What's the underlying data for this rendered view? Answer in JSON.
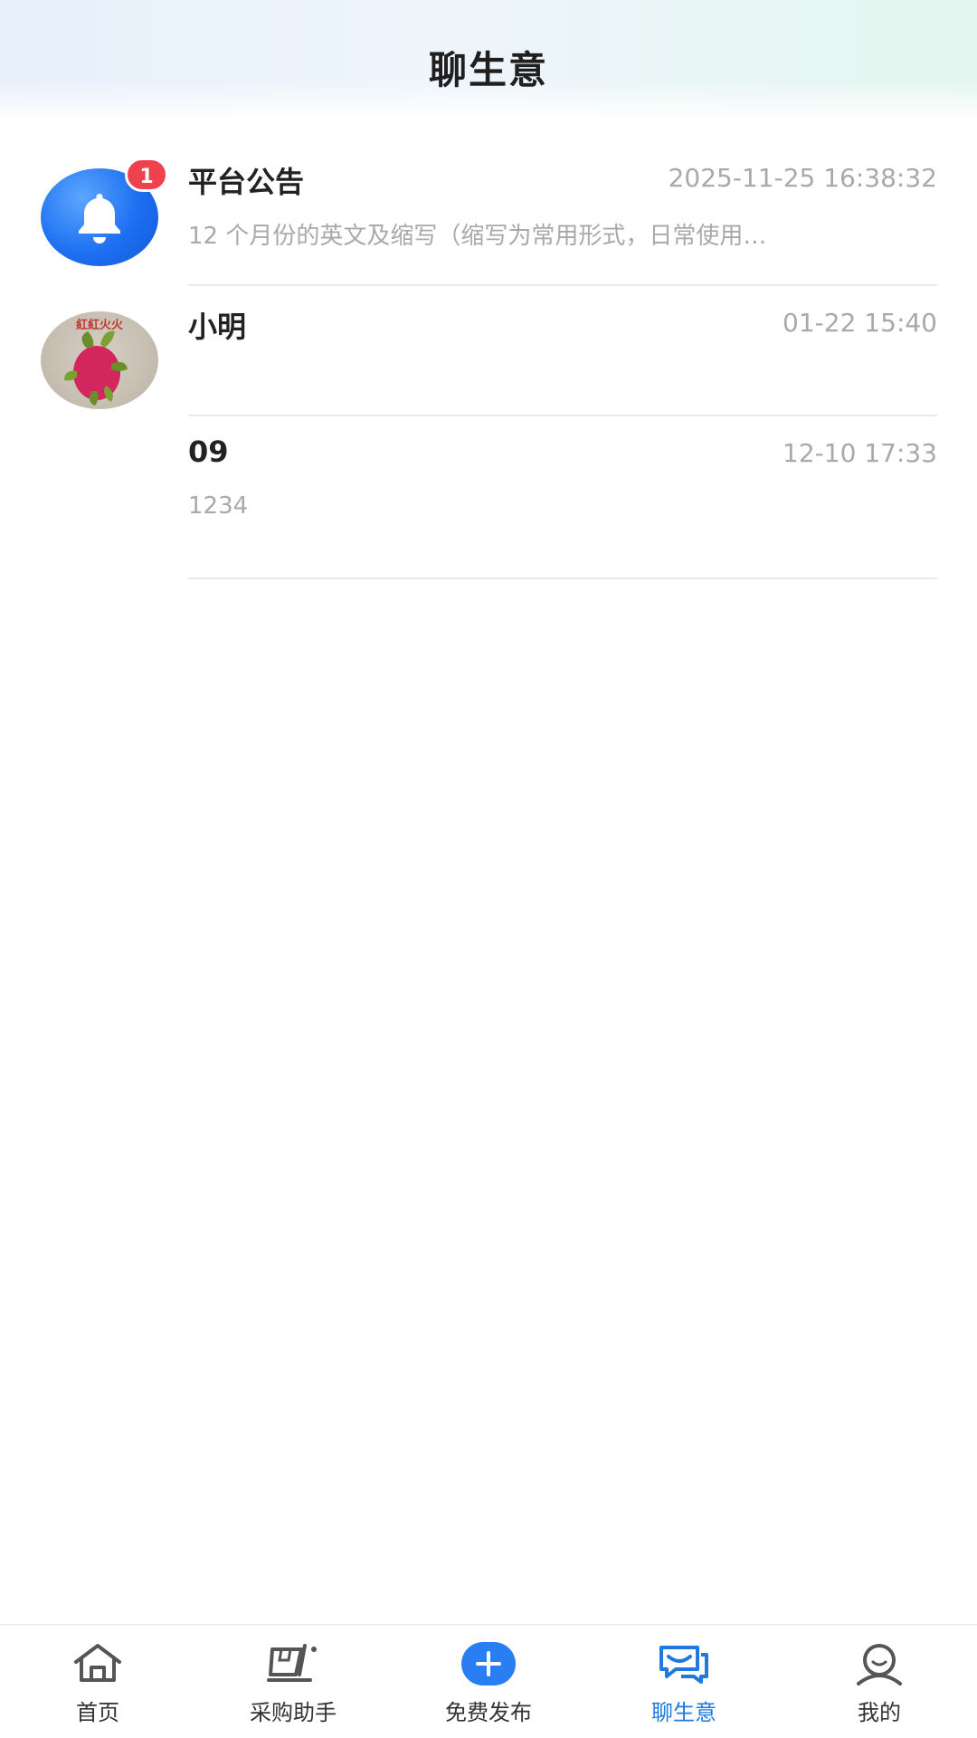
{
  "header": {
    "title": "聊生意"
  },
  "messages": [
    {
      "name": "平台公告",
      "time": "2025-11-25 16:38:32",
      "preview": "12 个月份的英文及缩写（缩写为常用形式，日常使用…",
      "badge": "1",
      "avatar_icon": "bell-icon"
    },
    {
      "name": "小明",
      "time": "01-22 15:40",
      "preview": "",
      "avatar_caption": "紅紅火火"
    },
    {
      "name": "09",
      "time": "12-10 17:33",
      "preview": "1234"
    }
  ],
  "tabbar": {
    "tabs": [
      {
        "label": "首页",
        "icon": "home-icon"
      },
      {
        "label": "采购助手",
        "icon": "cart-icon"
      },
      {
        "label": "免费发布",
        "icon": "plus-icon"
      },
      {
        "label": "聊生意",
        "icon": "chat-icon",
        "active": true
      },
      {
        "label": "我的",
        "icon": "user-icon"
      }
    ]
  },
  "colors": {
    "accent": "#1e7ae0",
    "badge": "#f0424c"
  }
}
